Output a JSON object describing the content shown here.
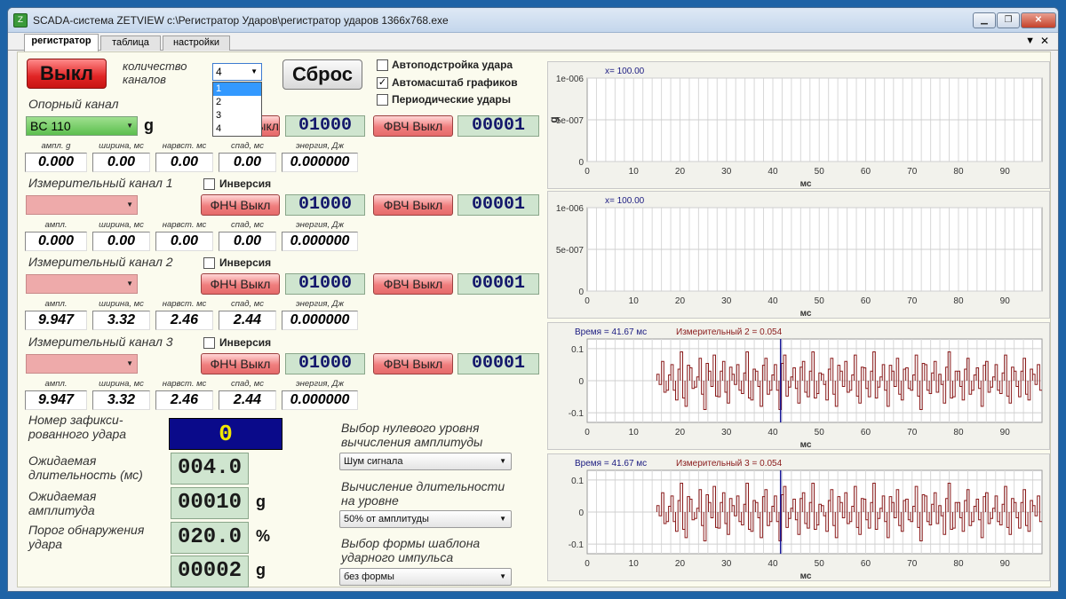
{
  "window": {
    "title": "SCADA-система ZETVIEW c:\\Регистратор Ударов\\регистратор ударов 1366x768.exe",
    "icon_name": "zetview-app-icon"
  },
  "tabs": [
    {
      "label": "регистратор"
    },
    {
      "label": "таблица"
    },
    {
      "label": "настройки"
    }
  ],
  "controls": {
    "stop_button": "Выкл",
    "channel_count_label": "количество каналов",
    "channel_count_value": "4",
    "channel_count_options": [
      "1",
      "2",
      "3",
      "4"
    ],
    "reset_button": "Сброс"
  },
  "options": {
    "auto_tune": {
      "label": "Автоподстройка удара",
      "checked": false
    },
    "auto_scale": {
      "label": "Автомасштаб графиков",
      "checked": true
    },
    "periodic": {
      "label": "Периодические удары",
      "checked": false
    }
  },
  "inversion_label": "Инверсия",
  "unit_g": "g",
  "channels": [
    {
      "title": "Опорный канал",
      "selector": "BC 110",
      "unit": "g",
      "lpf_label": "ФНЧ Выкл",
      "lpf_value": "01000",
      "hpf_label": "ФВЧ Выкл",
      "hpf_value": "00001",
      "m_labels": [
        "ампл. g",
        "ширина, мс",
        "нарвст. мс",
        "спад, мс",
        "энергия, Дж"
      ],
      "m_values": [
        "0.000",
        "0.00",
        "0.00",
        "0.00",
        "0.000000"
      ]
    },
    {
      "title": "Измерительный канал 1",
      "selector": "",
      "lpf_label": "ФНЧ Выкл",
      "lpf_value": "01000",
      "hpf_label": "ФВЧ Выкл",
      "hpf_value": "00001",
      "m_labels": [
        "ампл.",
        "ширина, мс",
        "нарвст. мс",
        "спад, мс",
        "энергия, Дж"
      ],
      "m_values": [
        "0.000",
        "0.00",
        "0.00",
        "0.00",
        "0.000000"
      ]
    },
    {
      "title": "Измерительный канал 2",
      "selector": "",
      "lpf_label": "ФНЧ Выкл",
      "lpf_value": "01000",
      "hpf_label": "ФВЧ Выкл",
      "hpf_value": "00001",
      "m_labels": [
        "ампл.",
        "ширина, мс",
        "нарвст. мс",
        "спад, мс",
        "энергия, Дж"
      ],
      "m_values": [
        "9.947",
        "3.32",
        "2.46",
        "2.44",
        "0.000000"
      ]
    },
    {
      "title": "Измерительный канал 3",
      "selector": "",
      "lpf_label": "ФНЧ Выкл",
      "lpf_value": "01000",
      "hpf_label": "ФВЧ Выкл",
      "hpf_value": "00001",
      "m_labels": [
        "ампл.",
        "ширина, мс",
        "нарвст. мс",
        "спад, мс",
        "энергия, Дж"
      ],
      "m_values": [
        "9.947",
        "3.32",
        "2.46",
        "2.44",
        "0.000000"
      ]
    }
  ],
  "bottom": {
    "shock_number_label": "Номер зафикси-рованного удара",
    "shock_number_value": "0",
    "duration_label": "Ожидаемая длительность (мс)",
    "duration_value": "004.0",
    "amplitude_label": "Ожидаемая амплитуда",
    "amplitude_value": "00010",
    "amplitude_unit": "g",
    "threshold_label": "Порог обнаружения удара",
    "threshold_value": "020.0",
    "threshold_unit": "%",
    "extra_value": "00002",
    "extra_unit": "g",
    "zero_level_label": "Выбор нулевого уровня вычисления амплитуды",
    "zero_level_value": "Шум сигнала",
    "duration_level_label": "Вычисление длительности на уровне",
    "duration_level_value": "50% от амплитуды",
    "template_label": "Выбор формы шаблона ударного импульса",
    "template_value": "без формы"
  },
  "chart_data": [
    {
      "type": "line",
      "cursor_label": "x= 100.00",
      "xlabel": "мс",
      "ylabel": "g",
      "xticks": [
        0,
        10,
        20,
        30,
        40,
        50,
        60,
        70,
        80,
        90
      ],
      "yticks": [
        "1e-006",
        "5e-007",
        "0"
      ],
      "xlim": [
        0,
        98
      ],
      "ylim": [
        0,
        1e-06
      ],
      "grid": true,
      "series": []
    },
    {
      "type": "line",
      "cursor_label": "x= 100.00",
      "xlabel": "мс",
      "ylabel": "",
      "xticks": [
        0,
        10,
        20,
        30,
        40,
        50,
        60,
        70,
        80,
        90
      ],
      "yticks": [
        "1e-006",
        "5e-007",
        "0"
      ],
      "xlim": [
        0,
        98
      ],
      "ylim": [
        0,
        1e-06
      ],
      "grid": true,
      "series": []
    },
    {
      "type": "line",
      "time_label": "Время = 41.67 мс",
      "value_label": "Измерительный 2 = 0.054",
      "xlabel": "мс",
      "ylabel": "",
      "xticks": [
        0,
        10,
        20,
        30,
        40,
        50,
        60,
        70,
        80,
        90
      ],
      "yticks": [
        "0.1",
        "0",
        "-0.1"
      ],
      "xlim": [
        0,
        98
      ],
      "ylim": [
        -0.13,
        0.13
      ],
      "cursor_x": 41.67,
      "grid": true,
      "signal_start": 15,
      "color": "#8a1b1b",
      "y": [
        0.02,
        0.06,
        -0.03,
        0.05,
        -0.06,
        0.09,
        -0.08,
        0.04,
        -0.02,
        0.07,
        -0.09,
        0.03,
        0.08,
        -0.05,
        0.06,
        -0.07,
        0.02,
        0.05,
        -0.04,
        0.09,
        -0.06,
        0.03,
        -0.08,
        0.07,
        -0.03,
        0.05,
        -0.09,
        0.08,
        -0.02,
        0.04,
        -0.07,
        0.06,
        -0.05,
        0.09,
        -0.04,
        0.02,
        -0.06,
        0.07,
        -0.08,
        0.03,
        0.06,
        -0.03,
        0.08,
        -0.07,
        0.04,
        -0.05,
        0.09,
        -0.02,
        0.05,
        -0.08,
        0.03,
        0.07,
        -0.06,
        0.04,
        -0.03,
        0.08,
        -0.09,
        0.05,
        -0.04,
        0.06,
        0.02,
        -0.07,
        0.09,
        -0.05,
        0.03,
        -0.06,
        0.07,
        -0.03,
        0.04,
        -0.08,
        0.06,
        -0.02,
        0.05,
        -0.04,
        0.08,
        -0.07,
        0.03,
        -0.05,
        0.07,
        -0.06,
        0.02,
        0.05
      ]
    },
    {
      "type": "line",
      "time_label": "Время = 41.67 мс",
      "value_label": "Измерительный 3 = 0.054",
      "xlabel": "мс",
      "ylabel": "",
      "xticks": [
        0,
        10,
        20,
        30,
        40,
        50,
        60,
        70,
        80,
        90
      ],
      "yticks": [
        "0.1",
        "0",
        "-0.1"
      ],
      "xlim": [
        0,
        98
      ],
      "ylim": [
        -0.13,
        0.13
      ],
      "cursor_x": 41.67,
      "grid": true,
      "signal_start": 15,
      "color": "#8a1b1b",
      "y": [
        0.02,
        0.06,
        -0.03,
        0.05,
        -0.06,
        0.09,
        -0.08,
        0.04,
        -0.02,
        0.07,
        -0.09,
        0.03,
        0.08,
        -0.05,
        0.06,
        -0.07,
        0.02,
        0.05,
        -0.04,
        0.09,
        -0.06,
        0.03,
        -0.08,
        0.07,
        -0.03,
        0.05,
        -0.09,
        0.08,
        -0.02,
        0.04,
        -0.07,
        0.06,
        -0.05,
        0.09,
        -0.04,
        0.02,
        -0.06,
        0.07,
        -0.08,
        0.03,
        0.06,
        -0.03,
        0.08,
        -0.07,
        0.04,
        -0.05,
        0.09,
        -0.02,
        0.05,
        -0.08,
        0.03,
        0.07,
        -0.06,
        0.04,
        -0.03,
        0.08,
        -0.09,
        0.05,
        -0.04,
        0.06,
        0.02,
        -0.07,
        0.09,
        -0.05,
        0.03,
        -0.06,
        0.07,
        -0.03,
        0.04,
        -0.08,
        0.06,
        -0.02,
        0.05,
        -0.04,
        0.08,
        -0.07,
        0.03,
        -0.05,
        0.07,
        -0.06,
        0.02,
        0.05
      ]
    }
  ]
}
